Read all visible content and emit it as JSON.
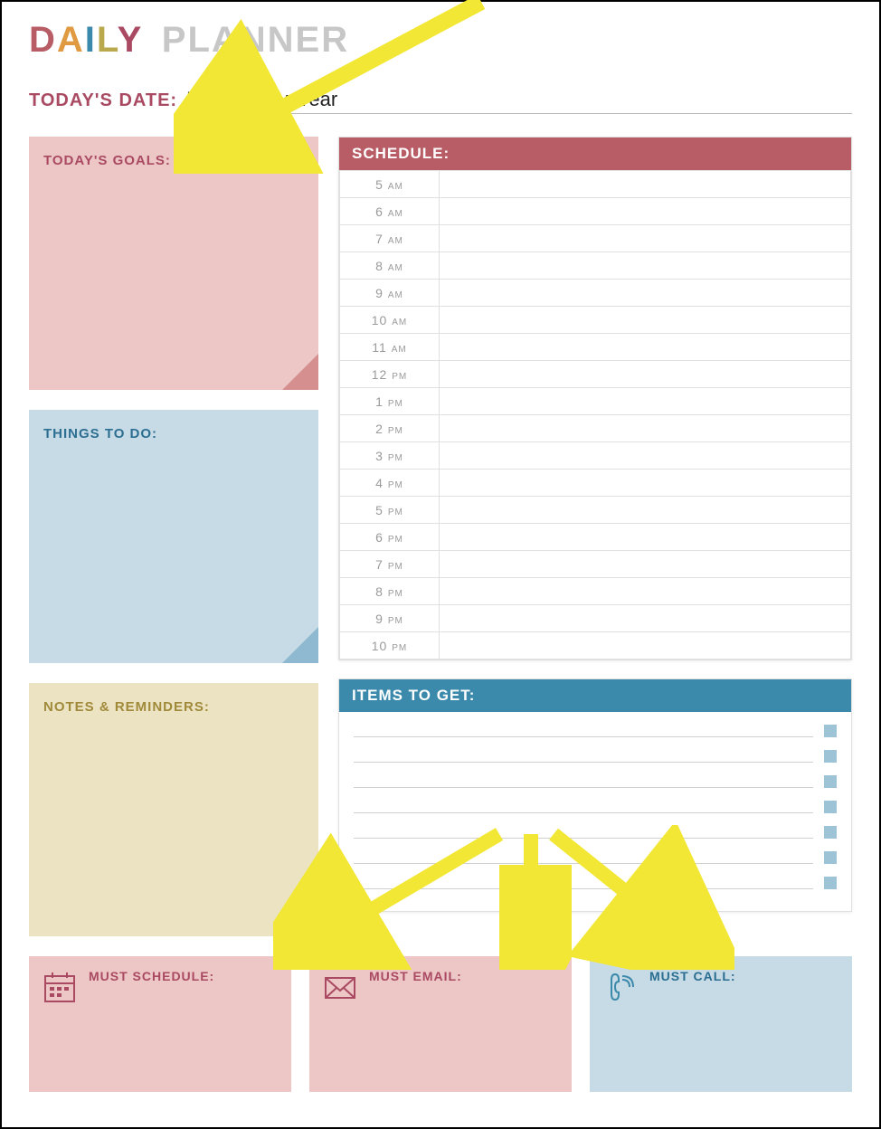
{
  "title": {
    "letters": [
      {
        "char": "D",
        "color": "#b85d66"
      },
      {
        "char": "A",
        "color": "#df9a42"
      },
      {
        "char": "I",
        "color": "#3c8aab"
      },
      {
        "char": "L",
        "color": "#b9a94c"
      },
      {
        "char": "Y",
        "color": "#a94a62"
      }
    ],
    "word2": "PLANNER",
    "word2_color": "#c7c7c7"
  },
  "date": {
    "label": "TODAY'S DATE:",
    "value": "Month, Day, Year"
  },
  "goals": {
    "title": "TODAY'S GOALS:"
  },
  "todo": {
    "title": "THINGS TO DO:"
  },
  "notes": {
    "title": "NOTES & REMINDERS:"
  },
  "schedule": {
    "title": "SCHEDULE:",
    "hours": [
      "5 am",
      "6 am",
      "7 am",
      "8 am",
      "9 am",
      "10 am",
      "11 am",
      "12 pm",
      "1 pm",
      "2 pm",
      "3 pm",
      "4 pm",
      "5 pm",
      "6 pm",
      "7 pm",
      "8 pm",
      "9 pm",
      "10 pm"
    ]
  },
  "items": {
    "title": "ITEMS TO GET:",
    "row_count": 7
  },
  "must": {
    "schedule": "MUST SCHEDULE:",
    "email": "MUST EMAIL:",
    "call": "MUST CALL:"
  }
}
